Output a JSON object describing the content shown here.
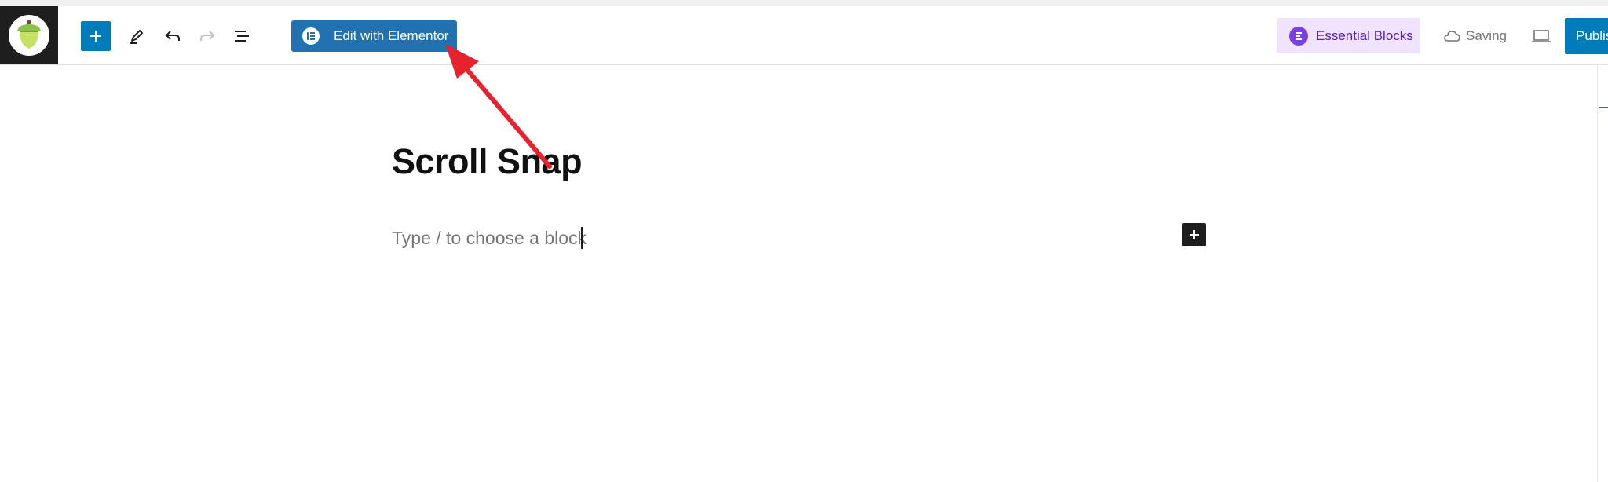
{
  "toolbar": {
    "site_logo_icon": "acorn-icon",
    "add_block_icon": "plus-icon",
    "tools_icon": "pencil-icon",
    "undo_icon": "undo-icon",
    "redo_icon": "redo-icon",
    "list_view_icon": "list-view-icon",
    "elementor_label": "Edit with Elementor",
    "essential_blocks_label": "Essential Blocks",
    "saving_label": "Saving",
    "publish_label": "Publis"
  },
  "editor": {
    "title": "Scroll Snap",
    "placeholder": "Type / to choose a block"
  },
  "colors": {
    "accent": "#007cba",
    "elementor_blue": "#2271b1",
    "essential_blocks_bg": "#efe3ff",
    "essential_blocks_text": "#5b21b6",
    "annotation_arrow": "#e8212e"
  }
}
